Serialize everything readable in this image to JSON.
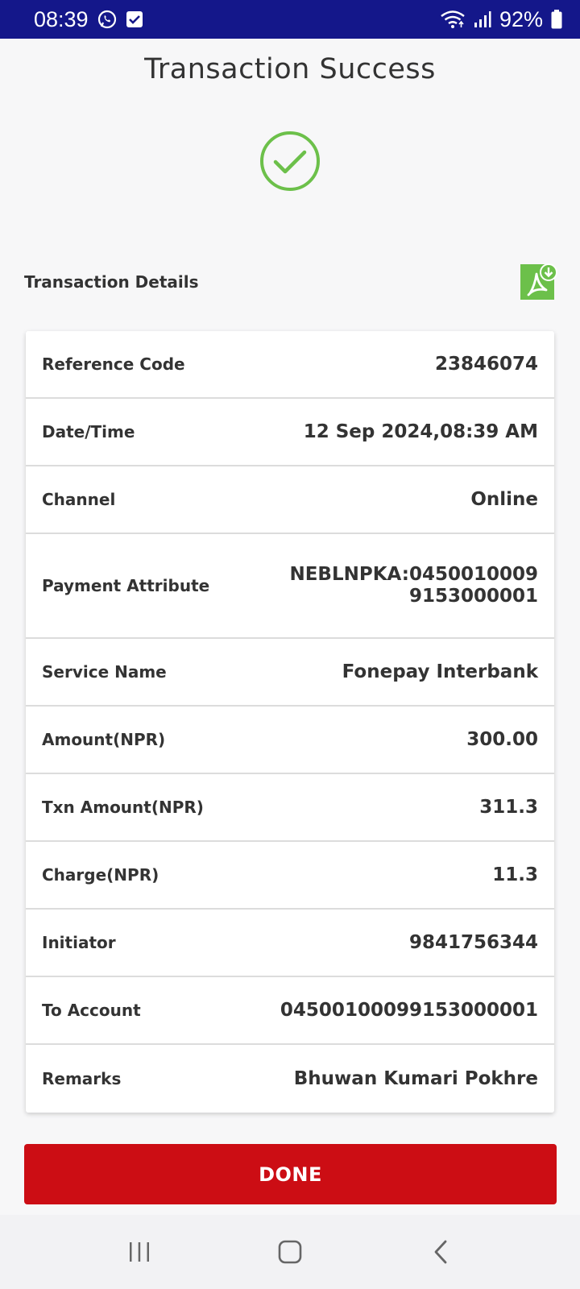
{
  "status_bar": {
    "time": "08:39",
    "battery": "92%",
    "icons": [
      "viber-icon",
      "checkbox-notification-icon",
      "wifi-icon",
      "signal-icon",
      "battery-icon"
    ]
  },
  "page": {
    "title": "Transaction Success",
    "details_heading": "Transaction Details",
    "success_icon": "check-circle-icon",
    "pdf_icon": "pdf-download-icon"
  },
  "details": [
    {
      "label": "Reference Code",
      "value": "23846074"
    },
    {
      "label": "Date/Time",
      "value": "12 Sep 2024,08:39 AM"
    },
    {
      "label": "Channel",
      "value": "Online"
    },
    {
      "label": "Payment Attribute",
      "value_line1": "NEBLNPKA:0450010009",
      "value_line2": "9153000001"
    },
    {
      "label": "Service Name",
      "value": "Fonepay Interbank"
    },
    {
      "label": "Amount(NPR)",
      "value": "300.00"
    },
    {
      "label": "Txn Amount(NPR)",
      "value": "311.3"
    },
    {
      "label": "Charge(NPR)",
      "value": "11.3"
    },
    {
      "label": "Initiator",
      "value": "9841756344"
    },
    {
      "label": "To Account",
      "value": "04500100099153000001"
    },
    {
      "label": "Remarks",
      "value": "Bhuwan Kumari Pokhre"
    }
  ],
  "actions": {
    "done_label": "DONE"
  },
  "colors": {
    "status_bar": "#14178a",
    "success_green": "#6cc04a",
    "done_red": "#cc0d14"
  }
}
